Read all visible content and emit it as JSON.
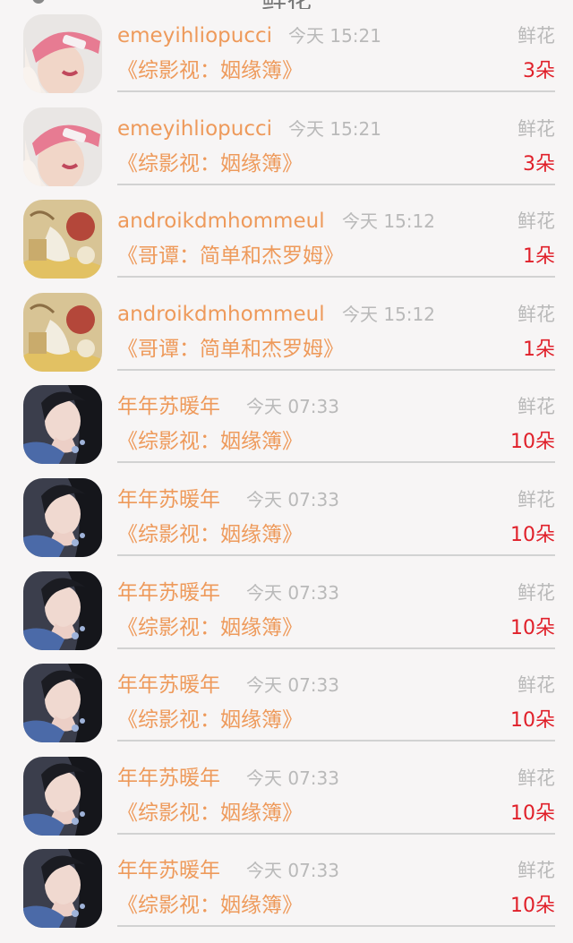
{
  "header": {
    "title": "鲜花"
  },
  "rows": [
    {
      "name": "emeyihliopucci",
      "time": "今天 15:21",
      "type": "鲜花",
      "work": "《综影视：姻缘簿》",
      "count": "3朵",
      "avatar": "pink-cap-girl-avatar"
    },
    {
      "name": "emeyihliopucci",
      "time": "今天 15:21",
      "type": "鲜花",
      "work": "《综影视：姻缘簿》",
      "count": "3朵",
      "avatar": "pink-cap-girl-avatar"
    },
    {
      "name": "androikdmhommeul",
      "time": "今天 15:12",
      "type": "鲜花",
      "work": "《哥谭：简单和杰罗姆》",
      "count": "1朵",
      "avatar": "anime-redhead-avatar"
    },
    {
      "name": "androikdmhommeul",
      "time": "今天 15:12",
      "type": "鲜花",
      "work": "《哥谭：简单和杰罗姆》",
      "count": "1朵",
      "avatar": "anime-redhead-avatar"
    },
    {
      "name": "年年苏暖年",
      "time": "今天 07:33",
      "type": "鲜花",
      "work": "《综影视：姻缘簿》",
      "count": "10朵",
      "avatar": "dark-hair-woman-avatar"
    },
    {
      "name": "年年苏暖年",
      "time": "今天 07:33",
      "type": "鲜花",
      "work": "《综影视：姻缘簿》",
      "count": "10朵",
      "avatar": "dark-hair-woman-avatar"
    },
    {
      "name": "年年苏暖年",
      "time": "今天 07:33",
      "type": "鲜花",
      "work": "《综影视：姻缘簿》",
      "count": "10朵",
      "avatar": "dark-hair-woman-avatar"
    },
    {
      "name": "年年苏暖年",
      "time": "今天 07:33",
      "type": "鲜花",
      "work": "《综影视：姻缘簿》",
      "count": "10朵",
      "avatar": "dark-hair-woman-avatar"
    },
    {
      "name": "年年苏暖年",
      "time": "今天 07:33",
      "type": "鲜花",
      "work": "《综影视：姻缘簿》",
      "count": "10朵",
      "avatar": "dark-hair-woman-avatar"
    },
    {
      "name": "年年苏暖年",
      "time": "今天 07:33",
      "type": "鲜花",
      "work": "《综影视：姻缘簿》",
      "count": "10朵",
      "avatar": "dark-hair-woman-avatar"
    }
  ],
  "colors": {
    "name": "#ee9a5b",
    "count": "#e0202a",
    "muted": "#b9b9b9",
    "divider": "#d2d2d2"
  }
}
